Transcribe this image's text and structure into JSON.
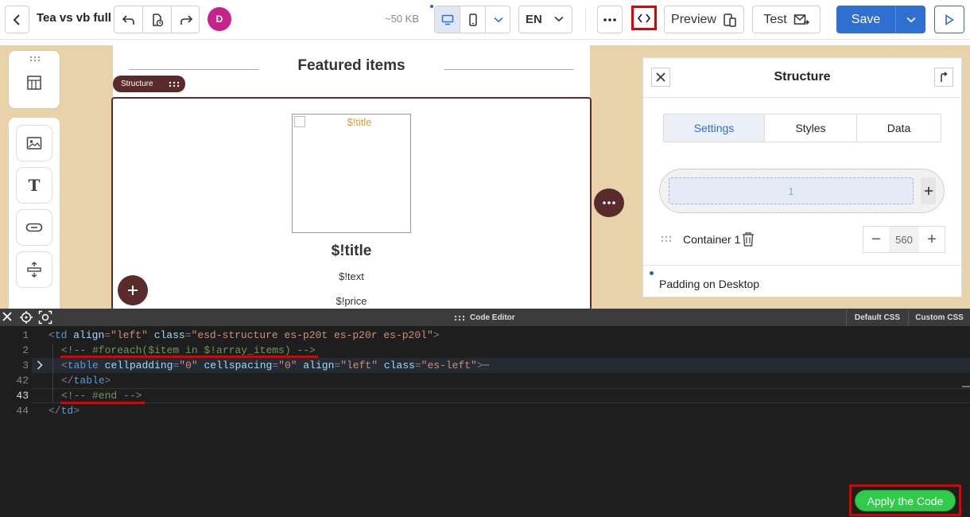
{
  "header": {
    "title": "Tea vs vb full",
    "avatar_initial": "D",
    "size": "~50 KB",
    "language": "EN",
    "preview_label": "Preview",
    "test_label": "Test",
    "save_label": "Save"
  },
  "canvas": {
    "section_title": "Featured items",
    "structure_tag": "Structure",
    "image_alt": "$!title",
    "item_title": "$!title",
    "item_text": "$!text",
    "item_price": "$!price"
  },
  "props": {
    "title": "Structure",
    "tabs": [
      "Settings",
      "Styles",
      "Data"
    ],
    "active_tab": "Settings",
    "layout_cell": "1",
    "container_label": "Container 1",
    "width_value": "560",
    "padding_label": "Padding on Desktop"
  },
  "editor": {
    "title": "Code Editor",
    "default_css": "Default CSS",
    "custom_css": "Custom CSS",
    "apply_label": "Apply the Code",
    "line_numbers": [
      "1",
      "2",
      "3",
      "42",
      "43",
      "44"
    ],
    "lines": [
      "<td align=\"left\" class=\"esd-structure es-p20t es-p20r es-p20l\">",
      "<!-- #foreach($item in $!array_items) -->",
      "<table cellpadding=\"0\" cellspacing=\"0\" align=\"left\" class=\"es-left\">⋯",
      "</table>",
      "<!-- #end -->",
      "</td>"
    ]
  },
  "colors": {
    "accent": "#2f6fd1",
    "highlight": "#e00000",
    "structure": "#5a2b2b",
    "canvas_bg": "#e8d2a9",
    "apply": "#2fcb49"
  }
}
